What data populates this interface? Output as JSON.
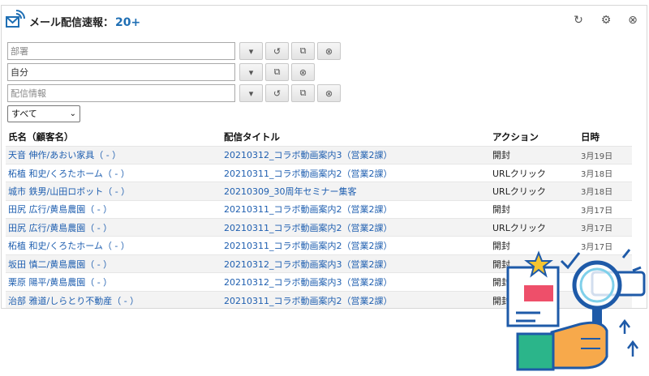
{
  "header": {
    "title": "メール配信速報：",
    "count": "20+",
    "icons": [
      "refresh-icon",
      "gear-icon",
      "close-icon"
    ]
  },
  "filters": {
    "department": {
      "placeholder": "部署",
      "value": ""
    },
    "owner": {
      "placeholder": "",
      "value": "自分"
    },
    "delivery": {
      "placeholder": "配信情報",
      "value": ""
    },
    "select_value": "すべて"
  },
  "table": {
    "columns": [
      "氏名（顧客名）",
      "配信タイトル",
      "アクション",
      "日時"
    ],
    "rows": [
      {
        "name": "天音 伸作/あおい家具（ - ）",
        "title": "20210312_コラボ動画案内3（営業2課）",
        "action": "開封",
        "date": "3月19日"
      },
      {
        "name": "柘植 和史/くろたホーム（ - ）",
        "title": "20210311_コラボ動画案内2（営業2課）",
        "action": "URLクリック",
        "date": "3月18日"
      },
      {
        "name": "城市 鉄男/山田ロボット（ - ）",
        "title": "20210309_30周年セミナー集客",
        "action": "URLクリック",
        "date": "3月18日"
      },
      {
        "name": "田尻 広行/黄島農園（ - ）",
        "title": "20210311_コラボ動画案内2（営業2課）",
        "action": "開封",
        "date": "3月17日"
      },
      {
        "name": "田尻 広行/黄島農園（ - ）",
        "title": "20210311_コラボ動画案内2（営業2課）",
        "action": "URLクリック",
        "date": "3月17日"
      },
      {
        "name": "柘植 和史/くろたホーム（ - ）",
        "title": "20210311_コラボ動画案内2（営業2課）",
        "action": "開封",
        "date": "3月17日"
      },
      {
        "name": "坂田 慎二/黄島農園（ - ）",
        "title": "20210312_コラボ動画案内3（営業2課）",
        "action": "開封",
        "date": ""
      },
      {
        "name": "栗原 陽平/黄島農園（ - ）",
        "title": "20210312_コラボ動画案内3（営業2課）",
        "action": "開封",
        "date": ""
      },
      {
        "name": "治部 雅道/しらとり不動産（ - ）",
        "title": "20210311_コラボ動画案内2（営業2課）",
        "action": "開封",
        "date": ""
      }
    ]
  }
}
